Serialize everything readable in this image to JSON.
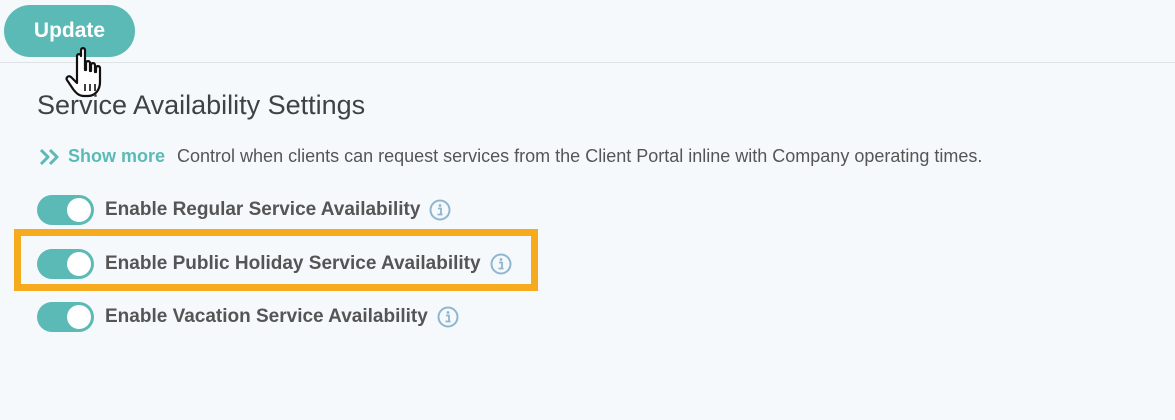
{
  "toolbar": {
    "update_label": "Update"
  },
  "section": {
    "title": "Service Availability Settings",
    "show_more_label": "Show more",
    "description": "Control when clients can request services from the Client Portal inline with Company operating times."
  },
  "settings": [
    {
      "label": "Enable Regular Service Availability",
      "enabled": true
    },
    {
      "label": "Enable Public Holiday Service Availability",
      "enabled": true,
      "highlighted": true
    },
    {
      "label": "Enable Vacation Service Availability",
      "enabled": true
    }
  ],
  "colors": {
    "accent": "#5bbab5",
    "highlight": "#f6ab1f",
    "background": "#f5f9fb"
  }
}
